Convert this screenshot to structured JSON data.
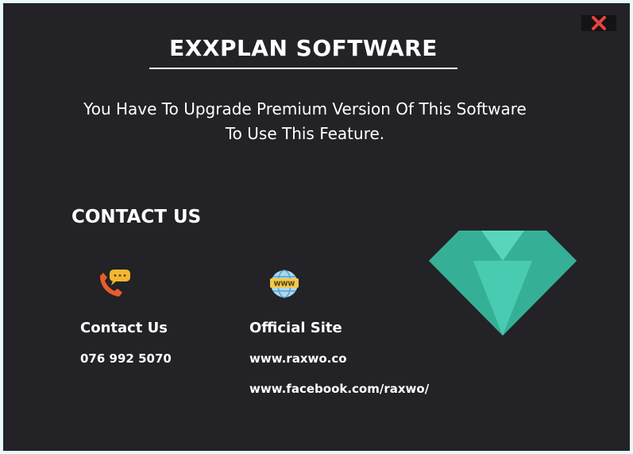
{
  "dialog": {
    "title": "EXXPLAN SOFTWARE",
    "message_line1": "You Have To Upgrade Premium Version Of This Software",
    "message_line2": "To Use This Feature.",
    "close_icon": "close-x-icon"
  },
  "contact": {
    "heading": "CONTACT US",
    "phone": {
      "icon": "phone-chat-icon",
      "title": "Contact Us",
      "number": "076 992 5070"
    },
    "site": {
      "icon": "www-globe-icon",
      "title": "Official Site",
      "links": [
        "www.raxwo.co",
        "www.facebook.com/raxwo/"
      ]
    }
  },
  "decoration": {
    "icon": "diamond-icon"
  },
  "colors": {
    "background": "#232226",
    "frame": "#e6fafb",
    "text": "#ffffff",
    "close": "#e8433a",
    "diamond": "#3ec3a8"
  }
}
